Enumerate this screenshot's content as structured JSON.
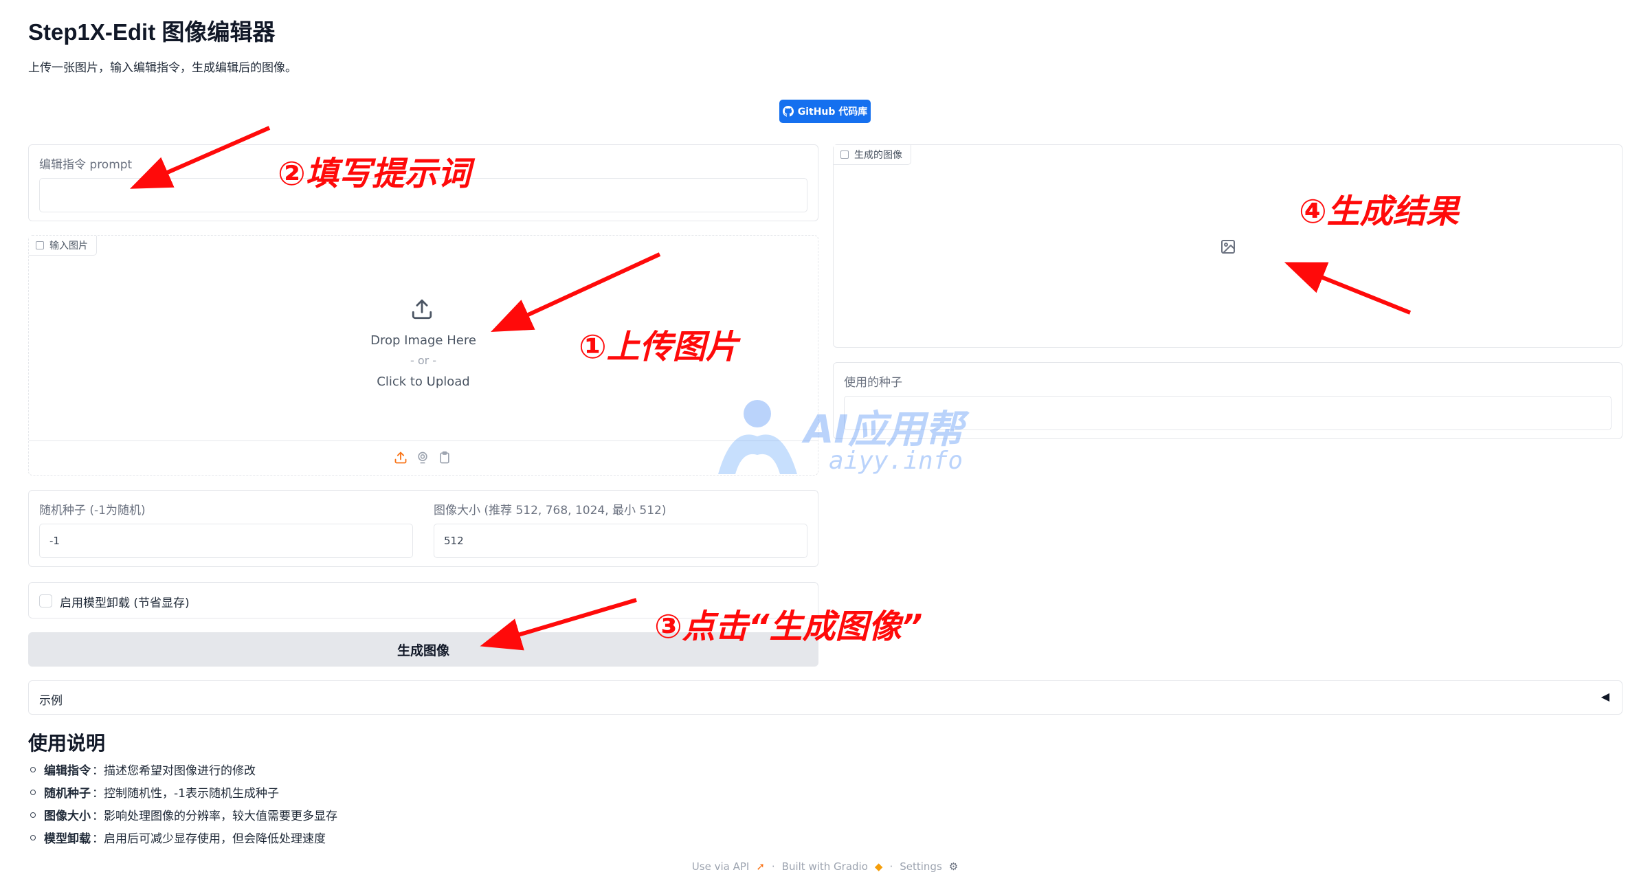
{
  "header": {
    "title": "Step1X-Edit 图像编辑器",
    "subtitle": "上传一张图片，输入编辑指令，生成编辑后的图像。",
    "github_label": "GitHub 代码库"
  },
  "prompt": {
    "label": "编辑指令 prompt",
    "value": ""
  },
  "input_image": {
    "tag": "输入图片",
    "drop_text": "Drop Image Here",
    "or_text": "- or -",
    "click_text": "Click to Upload"
  },
  "seed": {
    "label": "随机种子 (-1为随机)",
    "value": "-1"
  },
  "size": {
    "label": "图像大小 (推荐 512, 768, 1024, 最小 512)",
    "value": "512"
  },
  "offload": {
    "label": "启用模型卸载 (节省显存)",
    "checked": false
  },
  "generate_label": "生成图像",
  "examples": {
    "label": "示例",
    "toggle": "◀"
  },
  "output_image": {
    "tag": "生成的图像"
  },
  "used_seed": {
    "label": "使用的种子",
    "value": ""
  },
  "instructions": {
    "title": "使用说明",
    "items": [
      {
        "term": "编辑指令",
        "desc": "：描述您希望对图像进行的修改"
      },
      {
        "term": "随机种子",
        "desc": "：控制随机性，-1表示随机生成种子"
      },
      {
        "term": "图像大小",
        "desc": "：影响处理图像的分辨率，较大值需要更多显存"
      },
      {
        "term": "模型卸载",
        "desc": "：启用后可减少显存使用，但会降低处理速度"
      }
    ]
  },
  "footer": {
    "api": "Use via API",
    "sep1": "·",
    "built": "Built with Gradio",
    "sep2": "·",
    "settings": "Settings"
  },
  "annotations": {
    "step1": "①上传图片",
    "step2": "②填写提示词",
    "step3": "③点击“生成图像”",
    "step4": "④生成结果"
  },
  "watermark": {
    "name": "AI应用帮",
    "url": "aiyy.info"
  },
  "colors": {
    "accent": "#1570ef",
    "upload_orange": "#f97316",
    "annotation_red": "#ff0a0a"
  }
}
